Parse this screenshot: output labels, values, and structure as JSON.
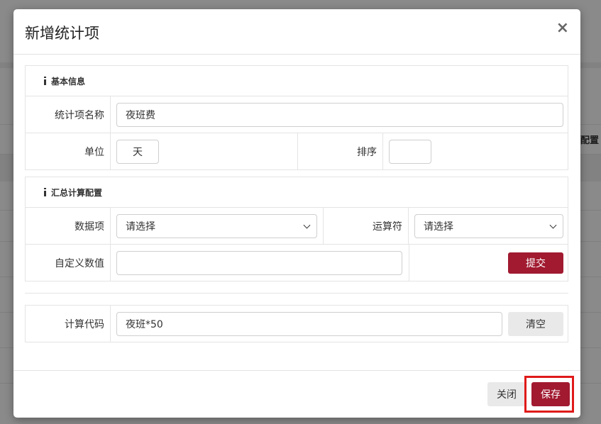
{
  "background": {
    "peek_text": "配置"
  },
  "modal": {
    "title": "新增统计项",
    "close_glyph": "×"
  },
  "basic_info": {
    "section_title": "基本信息",
    "name_label": "统计项名称",
    "name_value": "夜班费",
    "unit_label": "单位",
    "unit_value": "天",
    "sort_label": "排序",
    "sort_value": ""
  },
  "summary_config": {
    "section_title": "汇总计算配置",
    "data_item_label": "数据项",
    "data_item_selected": "请选择",
    "operator_label": "运算符",
    "operator_selected": "请选择",
    "custom_value_label": "自定义数值",
    "custom_value": "",
    "submit_label": "提交"
  },
  "code": {
    "label": "计算代码",
    "value": "夜班*50",
    "clear_label": "清空"
  },
  "footer": {
    "close_label": "关闭",
    "save_label": "保存"
  },
  "colors": {
    "primary": "#a11a30",
    "highlight": "#e01a1a"
  }
}
